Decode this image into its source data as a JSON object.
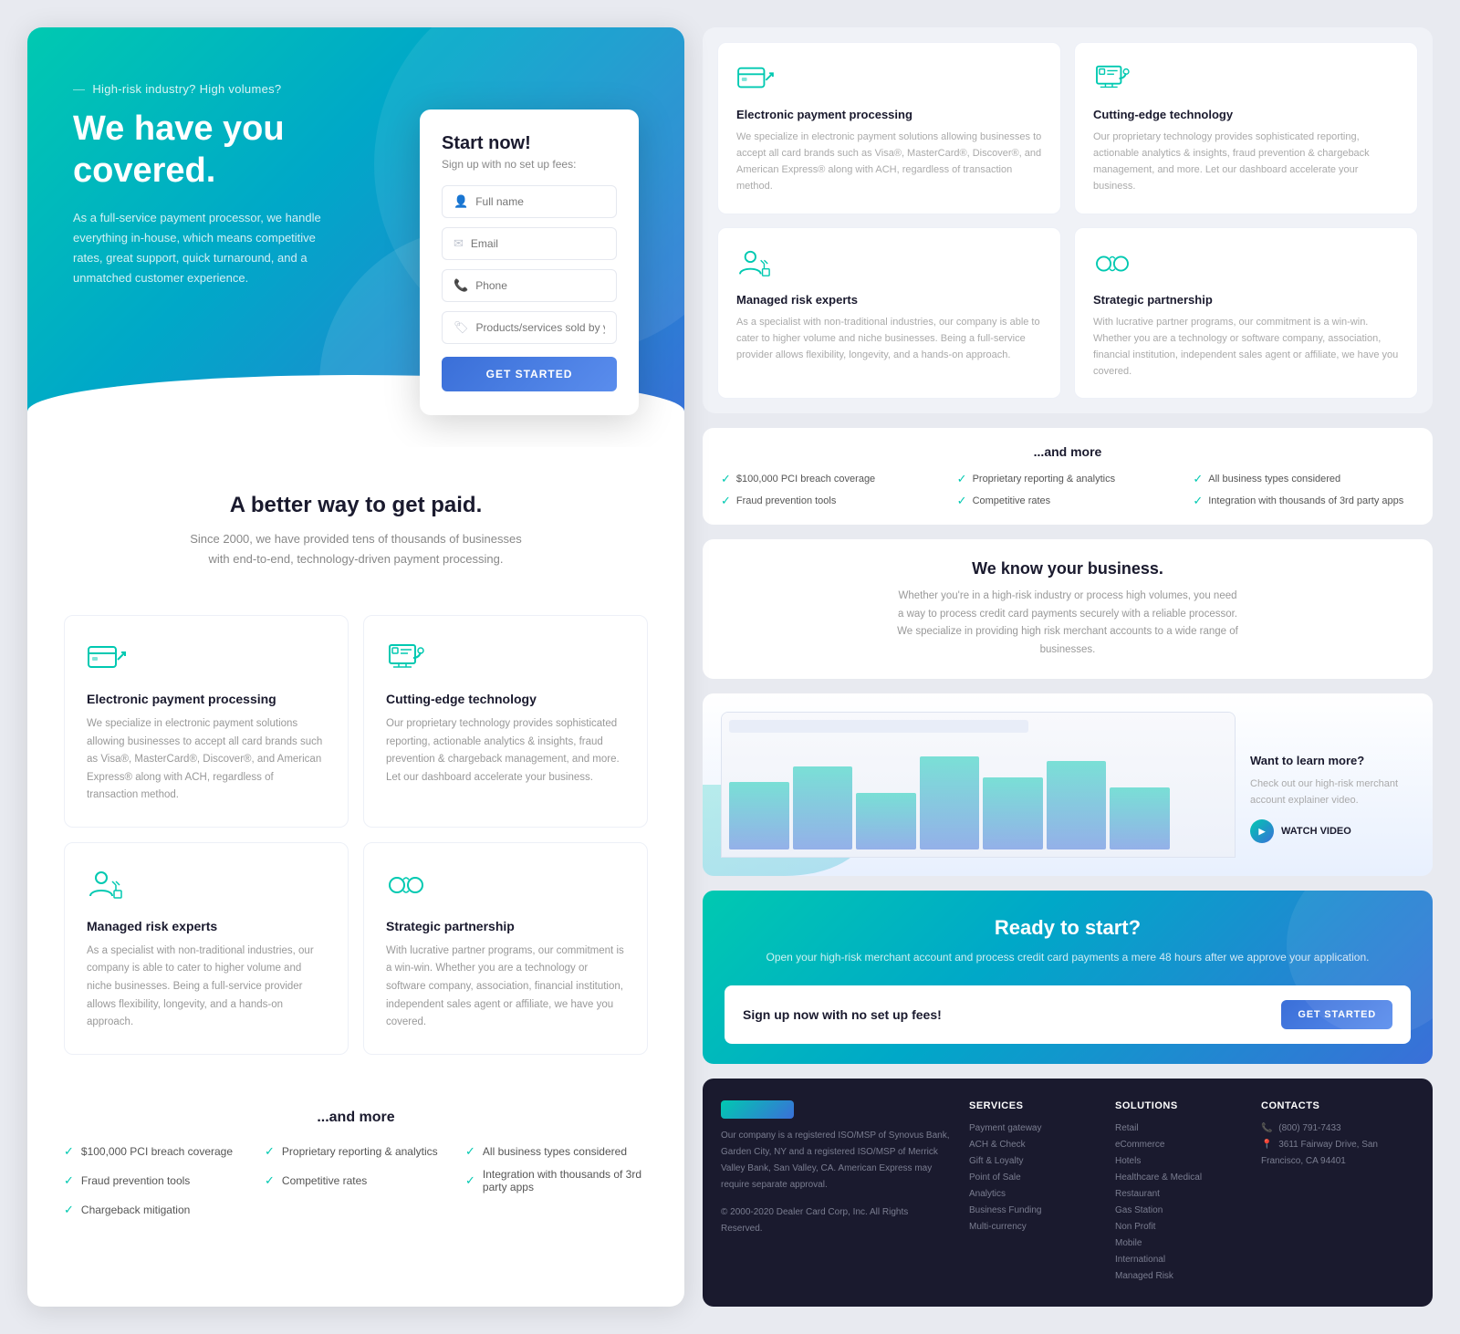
{
  "hero": {
    "tagline": "High-risk industry? High volumes?",
    "title": "We have you covered.",
    "description": "As a full-service payment processor, we handle everything in-house, which means competitive rates, great support, quick turnaround, and a unmatched customer experience."
  },
  "signup": {
    "title": "Start now!",
    "subtitle": "Sign up with no set up fees:",
    "fields": {
      "fullname": "Full name",
      "email": "Email",
      "phone": "Phone",
      "products": "Products/services sold by your business"
    },
    "cta": "GET STARTED"
  },
  "better_way": {
    "title": "A better way to get paid.",
    "description": "Since 2000, we have provided tens of thousands of businesses with end-to-end, technology-driven payment processing."
  },
  "features": [
    {
      "title": "Electronic payment processing",
      "description": "We specialize in electronic payment solutions allowing businesses to accept all card brands such as Visa®, MasterCard®, Discover®, and American Express® along with ACH, regardless of transaction method."
    },
    {
      "title": "Cutting-edge technology",
      "description": "Our proprietary technology provides sophisticated reporting, actionable analytics & insights, fraud prevention & chargeback management, and more. Let our dashboard accelerate your business."
    },
    {
      "title": "Managed risk experts",
      "description": "As a specialist with non-traditional industries, our company is able to cater to higher volume and niche businesses. Being a full-service provider allows flexibility, longevity, and a hands-on approach."
    },
    {
      "title": "Strategic partnership",
      "description": "With lucrative partner programs, our commitment is a win-win. Whether you are a technology or software company, association, financial institution, independent sales agent or affiliate, we have you covered."
    }
  ],
  "and_more": {
    "title": "...and more",
    "bullets": [
      "$100,000 PCI breach coverage",
      "Fraud prevention tools",
      "Chargeback mitigation",
      "Proprietary reporting & analytics",
      "Competitive rates",
      "",
      "All business types considered",
      "Integration with thousands of 3rd party apps",
      ""
    ]
  },
  "we_know": {
    "title": "We know your business.",
    "description": "Whether you're in a high-risk industry or process high volumes, you need a way to process credit card payments securely with a reliable processor. We specialize in providing high risk merchant accounts to a wide range of businesses."
  },
  "learn_more": {
    "title": "Want to learn more?",
    "description": "Check out our high-risk merchant account explainer video.",
    "cta": "WATCH VIDEO"
  },
  "ready": {
    "title": "Ready to start?",
    "description": "Open your high-risk merchant account and process credit card payments a mere 48 hours after we approve your application.",
    "signup_text": "Sign up now with no set up fees!",
    "cta": "GET STARTED"
  },
  "footer": {
    "services_title": "Services",
    "services": [
      "Payment gateway",
      "ACH & Check",
      "Gift & Loyalty",
      "Point of Sale",
      "Analytics",
      "Business Funding",
      "Multi-currency"
    ],
    "solutions_title": "Solutions",
    "solutions": [
      "Retail",
      "eCommerce",
      "Hotels",
      "Healthcare & Medical",
      "Restaurant",
      "Gas Station",
      "Non Profit",
      "Mobile",
      "International",
      "Managed Risk"
    ],
    "contacts_title": "Contacts",
    "phone": "(800) 791-7433",
    "address": "3611 Fairway Drive, San Francisco, CA 94401",
    "copyright": "© 2000-2020 Dealer Card Corp, Inc. All Rights Reserved."
  }
}
